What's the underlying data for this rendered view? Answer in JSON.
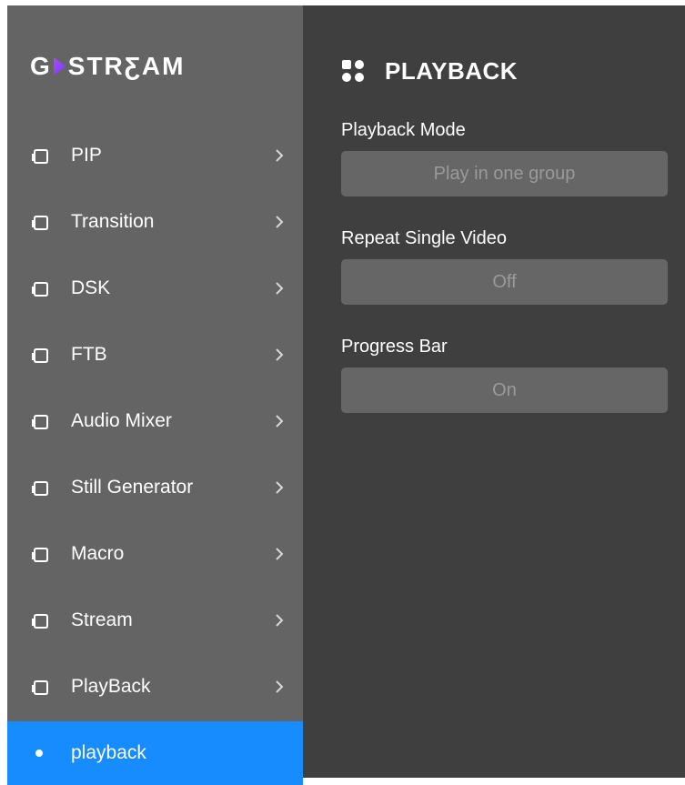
{
  "app": {
    "logo_text_left": "G",
    "logo_text_right": "STRƸAM"
  },
  "sidebar": {
    "items": [
      {
        "label": "PIP"
      },
      {
        "label": "Transition"
      },
      {
        "label": "DSK"
      },
      {
        "label": "FTB"
      },
      {
        "label": "Audio Mixer"
      },
      {
        "label": "Still Generator"
      },
      {
        "label": "Macro"
      },
      {
        "label": "Stream"
      },
      {
        "label": "PlayBack"
      }
    ],
    "active_item": {
      "label": "playback"
    },
    "icons": {
      "item": "folder-icon",
      "chevron": "chevron-right-icon",
      "active_dot": "dot-icon"
    },
    "colors": {
      "background": "#646464",
      "active": "#168cff"
    }
  },
  "panel": {
    "title": "PLAYBACK",
    "title_icon": "grid-icon",
    "fields": [
      {
        "label": "Playback Mode",
        "value": "Play in one group"
      },
      {
        "label": "Repeat Single Video",
        "value": "Off"
      },
      {
        "label": "Progress Bar",
        "value": "On"
      }
    ],
    "colors": {
      "background": "#3f3f3f",
      "field_box": "#666666",
      "field_text": "#9a9a9a"
    }
  }
}
